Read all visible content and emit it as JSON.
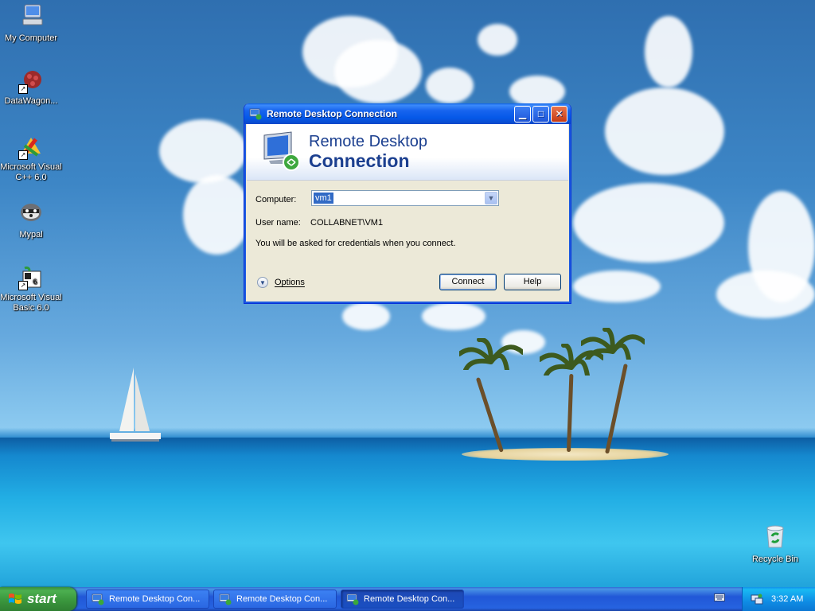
{
  "desktop_icons": [
    {
      "label": "My Computer",
      "icon": "my-computer-icon"
    },
    {
      "label": "DataWagon...",
      "icon": "datawagon-icon"
    },
    {
      "label": "Microsoft Visual C++ 6.0",
      "icon": "visual-cpp-icon"
    },
    {
      "label": "Mypal",
      "icon": "mypal-icon"
    },
    {
      "label": "Microsoft Visual Basic 6.0",
      "icon": "visual-basic-icon"
    },
    {
      "label": "Recycle Bin",
      "icon": "recycle-bin-icon"
    }
  ],
  "window": {
    "title": "Remote Desktop Connection",
    "banner_line1": "Remote Desktop",
    "banner_line2": "Connection",
    "computer_label": "Computer:",
    "computer_value": "vm1",
    "username_label": "User name:",
    "username_value": "COLLABNET\\VM1",
    "credentials_note": "You will be asked for credentials when you connect.",
    "options_label": "Options",
    "connect_label": "Connect",
    "help_label": "Help"
  },
  "taskbar": {
    "start_label": "start",
    "tasks": [
      {
        "label": "Remote Desktop Con...",
        "active": false
      },
      {
        "label": "Remote Desktop Con...",
        "active": false
      },
      {
        "label": "Remote Desktop Con...",
        "active": true
      }
    ],
    "clock": "3:32 AM"
  },
  "colors": {
    "titlebar_blue": "#0558e8",
    "start_green": "#3c9a3f",
    "dialog_bg": "#ece9d8",
    "banner_text": "#1b3f8f"
  }
}
